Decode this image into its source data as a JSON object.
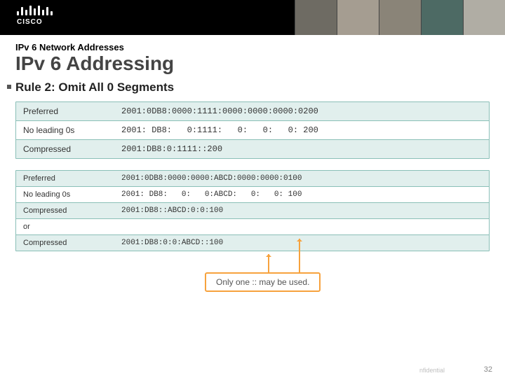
{
  "brand": "CISCO",
  "breadcrumb": "IPv 6 Network Addresses",
  "title": "IPv 6 Addressing",
  "rule": "Rule 2: Omit All 0 Segments",
  "example1": {
    "rows": [
      {
        "label": "Preferred",
        "value": "2001:0DB8:0000:1111:0000:0000:0000:0200"
      },
      {
        "label": "No leading 0s",
        "value": "2001: DB8:   0:1111:   0:   0:   0: 200"
      },
      {
        "label": "Compressed",
        "value": "2001:DB8:0:1111::200"
      }
    ]
  },
  "example2": {
    "rows": [
      {
        "label": "Preferred",
        "value": "2001:0DB8:0000:0000:ABCD:0000:0000:0100"
      },
      {
        "label": "No leading 0s",
        "value": "2001: DB8:   0:   0:ABCD:   0:   0: 100"
      },
      {
        "label": "Compressed",
        "value": "2001:DB8::ABCD:0:0:100"
      },
      {
        "label": "or",
        "value": ""
      },
      {
        "label": "Compressed",
        "value": "2001:DB8:0:0:ABCD::100"
      }
    ]
  },
  "callout": "Only one :: may be used.",
  "footer": {
    "confidential": "nfidential",
    "page": "32"
  }
}
